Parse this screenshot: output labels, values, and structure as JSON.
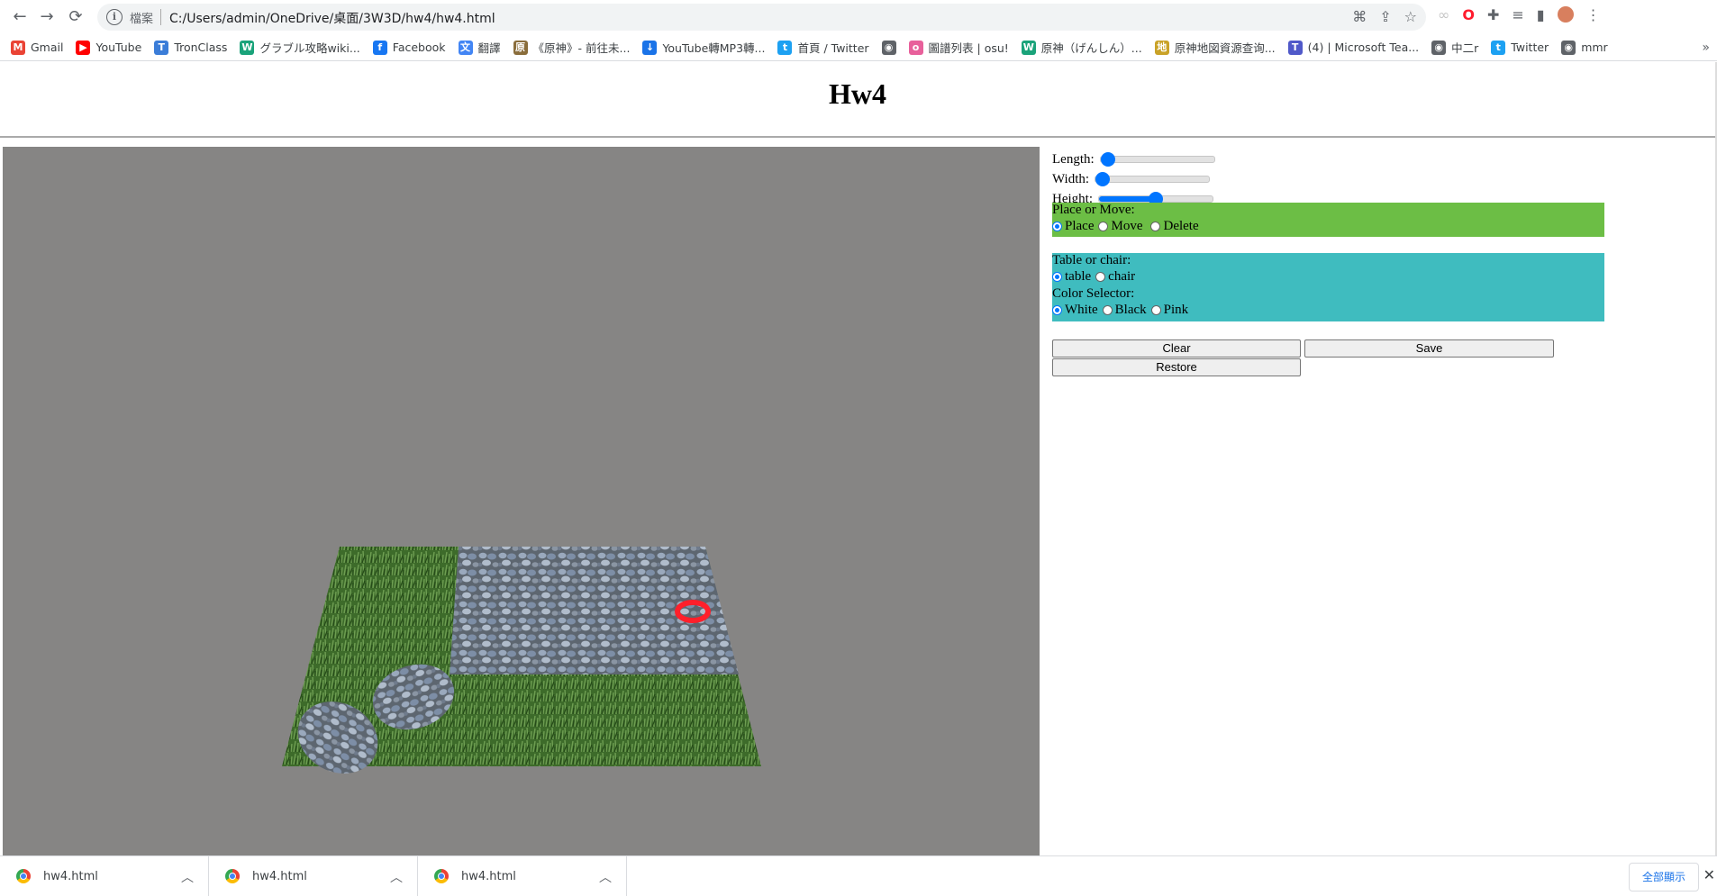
{
  "browser": {
    "nav": {
      "back": "←",
      "forward": "→",
      "reload": "⟳"
    },
    "address": {
      "scheme_label": "檔案",
      "url": "C:/Users/admin/OneDrive/桌面/3W3D/hw4/hw4.html"
    },
    "bookmarks": [
      {
        "label": "Gmail",
        "icon": "gmail-icon",
        "color": "#ea4335",
        "glyph": "M"
      },
      {
        "label": "YouTube",
        "icon": "youtube-icon",
        "color": "#ff0000",
        "glyph": "▶"
      },
      {
        "label": "TronClass",
        "icon": "tronclass-icon",
        "color": "#3b7dd8",
        "glyph": "T"
      },
      {
        "label": "グラブル攻略wiki...",
        "icon": "wiki-icon",
        "color": "#1aa37a",
        "glyph": "W"
      },
      {
        "label": "Facebook",
        "icon": "facebook-icon",
        "color": "#1877f2",
        "glyph": "f"
      },
      {
        "label": "翻譯",
        "icon": "translate-icon",
        "color": "#4285f4",
        "glyph": "文"
      },
      {
        "label": "《原神》- 前往未...",
        "icon": "genshin-icon",
        "color": "#8a6d3b",
        "glyph": "原"
      },
      {
        "label": "YouTube轉MP3轉...",
        "icon": "converter-icon",
        "color": "#1a73e8",
        "glyph": "↓"
      },
      {
        "label": "首頁 / Twitter",
        "icon": "twitter-icon",
        "color": "#1da1f2",
        "glyph": "t"
      },
      {
        "label": "",
        "icon": "globe-icon",
        "color": "#5f6368",
        "glyph": "◉"
      },
      {
        "label": "圖譜列表 | osu!",
        "icon": "osu-icon",
        "color": "#e8609b",
        "glyph": "o"
      },
      {
        "label": "原神（げんしん）...",
        "icon": "wiki2-icon",
        "color": "#1aa37a",
        "glyph": "W"
      },
      {
        "label": "原神地図資源查询...",
        "icon": "map-icon",
        "color": "#c9a227",
        "glyph": "地"
      },
      {
        "label": "(4) | Microsoft Tea...",
        "icon": "teams-icon",
        "color": "#5059c9",
        "glyph": "T"
      },
      {
        "label": "中二r",
        "icon": "globe2-icon",
        "color": "#5f6368",
        "glyph": "◉"
      },
      {
        "label": "Twitter",
        "icon": "twitter2-icon",
        "color": "#1da1f2",
        "glyph": "t"
      },
      {
        "label": "mmr",
        "icon": "globe3-icon",
        "color": "#5f6368",
        "glyph": "◉"
      }
    ],
    "bookmarks_more": "»"
  },
  "page": {
    "title": "Hw4",
    "canvas_bg": "#868584"
  },
  "controls": {
    "sliders": [
      {
        "label": "Length:",
        "value": 0.0
      },
      {
        "label": "Width:",
        "value": 0.0
      },
      {
        "label": "Height:",
        "value": 0.5
      }
    ],
    "mode": {
      "heading": "Place or Move:",
      "options": [
        "Place",
        "Move",
        "Delete"
      ],
      "selected": "Place",
      "bg": "#6cbe45"
    },
    "object": {
      "heading": "Table or chair:",
      "options": [
        "table",
        "chair"
      ],
      "selected": "table"
    },
    "color": {
      "heading": "Color Selector:",
      "options": [
        "White",
        "Black",
        "Pink"
      ],
      "selected": "White",
      "bg": "#3fbcbf"
    },
    "buttons": {
      "clear": "Clear",
      "save": "Save",
      "restore": "Restore"
    }
  },
  "downloads": {
    "items": [
      "hw4.html",
      "hw4.html",
      "hw4.html"
    ],
    "show_all": "全部顯示",
    "close": "✕"
  }
}
